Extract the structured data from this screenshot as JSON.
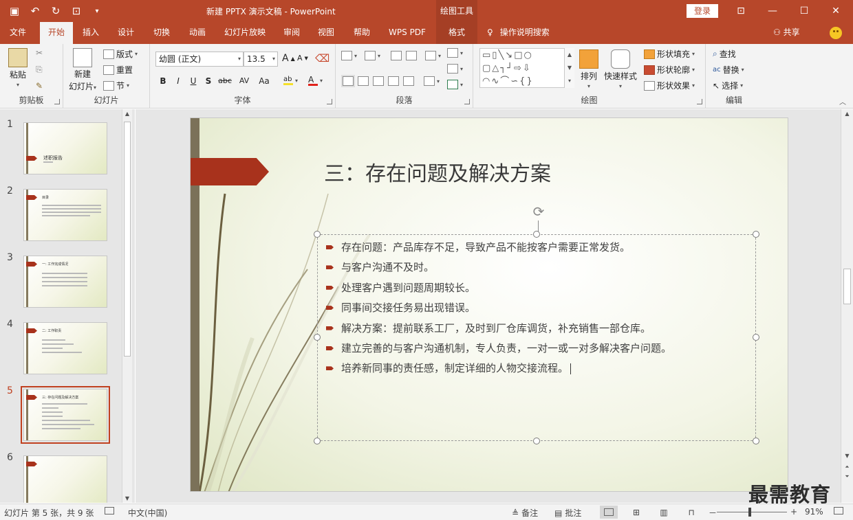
{
  "window": {
    "title": "新建 PPTX 演示文稿  -  PowerPoint",
    "contextual_tab": "绘图工具",
    "sign_in": "登录"
  },
  "tabs": {
    "file": "文件",
    "home": "开始",
    "insert": "插入",
    "design": "设计",
    "transitions": "切换",
    "animations": "动画",
    "slideshow": "幻灯片放映",
    "review": "审阅",
    "view": "视图",
    "help": "帮助",
    "wpspdf": "WPS PDF",
    "format": "格式",
    "tellme": "操作说明搜索",
    "share": "共享"
  },
  "ribbon": {
    "clipboard": {
      "label": "剪贴板",
      "paste": "粘贴"
    },
    "slides": {
      "label": "幻灯片",
      "new_slide_1": "新建",
      "new_slide_2": "幻灯片",
      "layout": "版式",
      "reset": "重置",
      "section": "节"
    },
    "font": {
      "label": "字体",
      "font_name": "幼圆 (正文)",
      "font_size": "13.5",
      "bold": "B",
      "italic": "I",
      "underline": "U",
      "shadow": "S",
      "strike": "abc",
      "spacing": "AV",
      "case": "Aa",
      "grow": "A",
      "shrink": "A"
    },
    "paragraph": {
      "label": "段落"
    },
    "drawing": {
      "label": "绘图",
      "arrange": "排列",
      "quick_styles": "快速样式",
      "shape_fill": "形状填充",
      "shape_outline": "形状轮廓",
      "shape_effects": "形状效果"
    },
    "editing": {
      "label": "编辑",
      "find": "查找",
      "replace": "替换",
      "select": "选择"
    }
  },
  "thumbnails": [
    {
      "number": "1",
      "title": "述职报告"
    },
    {
      "number": "2",
      "title": "目录"
    },
    {
      "number": "3",
      "title": "一: 工作完成情况"
    },
    {
      "number": "4",
      "title": "二: 工作职责"
    },
    {
      "number": "5",
      "title": "三: 存在问题及解决方案"
    },
    {
      "number": "6",
      "title": ""
    }
  ],
  "slide": {
    "title": "三：存在问题及解决方案",
    "bullets": [
      "存在问题：产品库存不足，导致产品不能按客户需要正常发货。",
      "与客户沟通不及时。",
      "处理客户遇到问题周期较长。",
      "同事间交接任务易出现错误。",
      "解决方案：提前联系工厂，及时到厂仓库调货，补充销售一部仓库。",
      "建立完善的与客户沟通机制，专人负责，一对一或一对多解决客户问题。",
      "培养新同事的责任感，制定详细的人物交接流程。"
    ]
  },
  "watermark": "最需教育",
  "status": {
    "slide_info": "幻灯片 第 5 张，共 9 张",
    "language": "中文(中国)",
    "notes": "备注",
    "comments": "批注",
    "zoom_minus": "－",
    "zoom_plus": "+",
    "zoom": "91%"
  },
  "colors": {
    "accent": "#b7472a",
    "bullet": "#a8321c"
  }
}
